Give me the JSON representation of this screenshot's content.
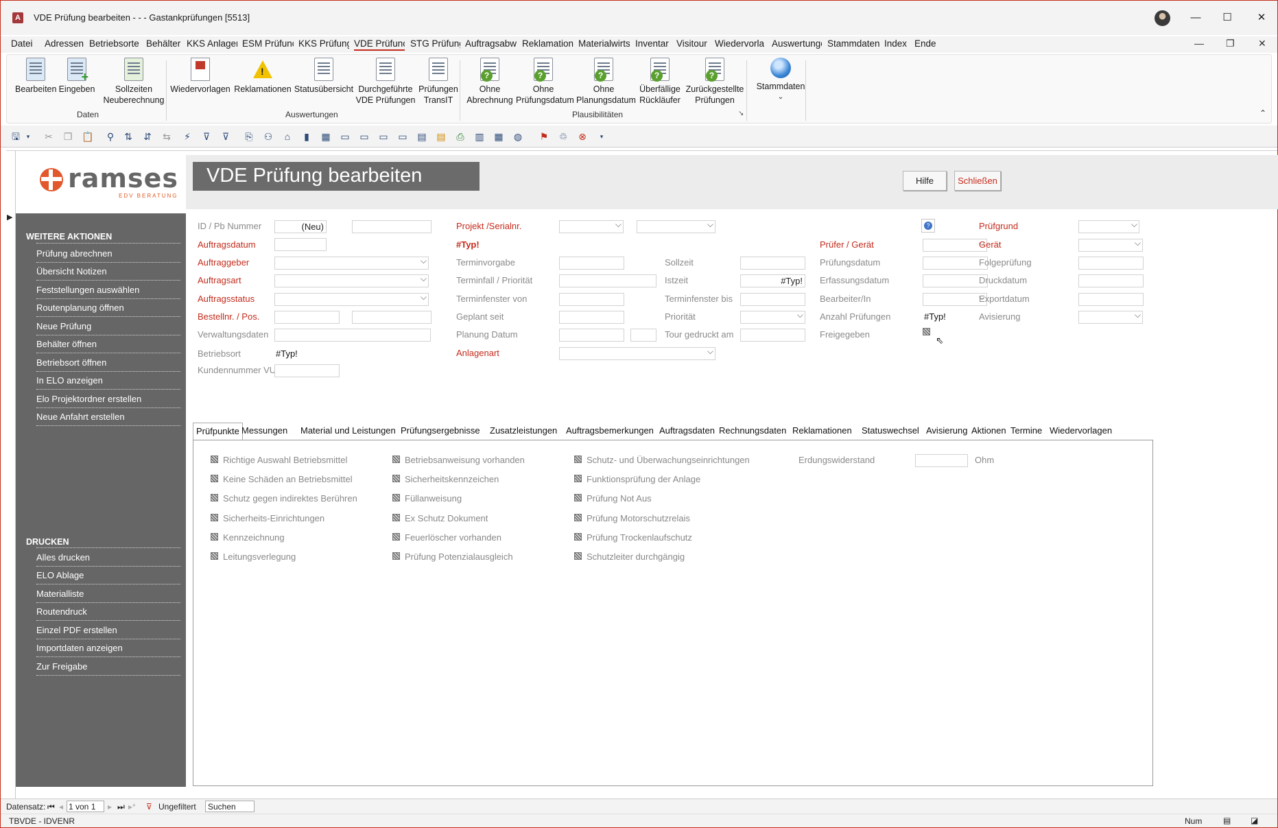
{
  "window": {
    "title": "VDE Prüfung bearbeiten -  -  - Gastankprüfungen [5513]",
    "minimize": "—",
    "maximize": "☐",
    "close": "✕"
  },
  "menu": [
    "Datei",
    "Adressen",
    "Betriebsorte",
    "Behälter",
    "KKS Anlager",
    "ESM Prüfunç",
    "KKS Prüfung",
    "VDE Prüfunç",
    "STG Prüfung",
    "Auftragsabw",
    "Reklamation",
    "Materialwirts",
    "Inventar",
    "Visitour",
    "Wiedervorla",
    "Auswertunge",
    "Stammdaten",
    "Index",
    "Ende"
  ],
  "ribbon": {
    "daten": {
      "label": "Daten",
      "buttons": [
        "Bearbeiten",
        "Eingeben",
        "Sollzeiten Neuberechnung"
      ]
    },
    "auswertungen": {
      "label": "Auswertungen",
      "buttons": [
        "Wiedervorlagen",
        "Reklamationen",
        "Statusübersicht",
        "Durchgeführte VDE Prüfungen",
        "Prüfungen TransIT"
      ]
    },
    "plausi": {
      "label": "Plausibilitäten",
      "buttons": [
        "Ohne Abrechnung",
        "Ohne Prüfungsdatum",
        "Ohne Planungsdatum",
        "Überfällige Rückläufer",
        "Zurückgestellte Prüfungen"
      ]
    },
    "stammdaten": {
      "label": "Stammdaten"
    }
  },
  "logo": {
    "text": "ramses",
    "sub": "EDV BERATUNG"
  },
  "page_title": "VDE Prüfung bearbeiten",
  "buttons": {
    "hilfe": "Hilfe",
    "schliessen": "Schließen"
  },
  "side": {
    "weitere_head": "WEITERE AKTIONEN",
    "weitere": [
      "Prüfung abrechnen",
      "Übersicht Notizen",
      "Feststellungen auswählen",
      "Routenplanung öffnen",
      "Neue Prüfung",
      "Behälter öffnen",
      "Betriebsort öffnen",
      "In ELO anzeigen",
      "Elo Projektordner erstellen",
      "Neue Anfahrt erstellen"
    ],
    "drucken_head": "DRUCKEN",
    "drucken": [
      "Alles drucken",
      "ELO Ablage",
      "Materialliste",
      "Routendruck",
      "Einzel PDF erstellen",
      "Importdaten anzeigen",
      "Zur Freigabe"
    ]
  },
  "labels": {
    "id_pb": "ID / Pb Nummer",
    "auftragsdatum": "Auftragsdatum",
    "auftraggeber": "Auftraggeber",
    "auftragsart": "Auftragsart",
    "auftragsstatus": "Auftragsstatus",
    "bestellnr": "Bestellnr. / Pos.",
    "verwaltungsdaten": "Verwaltungsdaten",
    "betriebsort": "Betriebsort",
    "kundennummer": "Kundennummer VU",
    "projekt": "Projekt /Serialnr.",
    "terminvorgabe": "Terminvorgabe",
    "terminfall": "Terminfall / Priorität",
    "terminfenster_von": "Terminfenster von",
    "geplant_seit": "Geplant seit",
    "planung_datum": "Planung Datum",
    "anlagenart": "Anlagenart",
    "sollzeit": "Sollzeit",
    "istzeit": "Istzeit",
    "terminfenster_bis": "Terminfenster bis",
    "prioritaet": "Priorität",
    "tour_gedruckt": "Tour gedruckt am",
    "pruefer_geraet": "Prüfer / Gerät",
    "pruefungsdatum": "Prüfungsdatum",
    "erfassungsdatum": "Erfassungsdatum",
    "bearbeiter": "Bearbeiter/In",
    "anzahl_pruefungen": "Anzahl Prüfungen",
    "freigegeben": "Freigegeben",
    "pruefgrund": "Prüfgrund",
    "geraet": "Gerät",
    "folgepruefung": "Folgeprüfung",
    "druckdatum": "Druckdatum",
    "exportdatum": "Exportdatum",
    "avisierung": "Avisierung"
  },
  "values": {
    "id_neu": "(Neu)",
    "typ_error": "#Typ!",
    "betriebsort": "#Typ!",
    "istzeit": "#Typ!",
    "anzahl": "#Typ!"
  },
  "tabs": [
    "Prüfpunkte",
    "Messungen",
    "Material und Leistungen",
    "Prüfungsergebnisse",
    "Zusatzleistungen",
    "Auftragsbemerkungen",
    "Auftragsdaten",
    "Rechnungsdaten",
    "Reklamationen",
    "Statuswechsel",
    "Avisierung",
    "Aktionen",
    "Termine",
    "Wiedervorlagen"
  ],
  "pruefpunkte": {
    "col1": [
      "Richtige Auswahl Betriebsmittel",
      "Keine Schäden an Betriebsmittel",
      "Schutz gegen indirektes Berühren",
      "Sicherheits-Einrichtungen",
      "Kennzeichnung",
      "Leitungsverlegung"
    ],
    "col2": [
      "Betriebsanweisung vorhanden",
      "Sicherheitskennzeichen",
      "Füllanweisung",
      "Ex Schutz Dokument",
      "Feuerlöscher vorhanden",
      "Prüfung Potenzialausgleich"
    ],
    "col3": [
      "Schutz- und Überwachungseinrichtungen",
      "Funktionsprüfung der Anlage",
      "Prüfung Not Aus",
      "Prüfung Motorschutzrelais",
      "Prüfung Trockenlaufschutz",
      "Schutzleiter durchgängig"
    ],
    "erdung_label": "Erdungswiderstand",
    "erdung_unit": "Ohm"
  },
  "nav": {
    "datensatz": "Datensatz:",
    "position": "1 von 1",
    "filter": "Ungefiltert",
    "search": "Suchen"
  },
  "status": {
    "left": "TBVDE - IDVENR",
    "num": "Num"
  }
}
